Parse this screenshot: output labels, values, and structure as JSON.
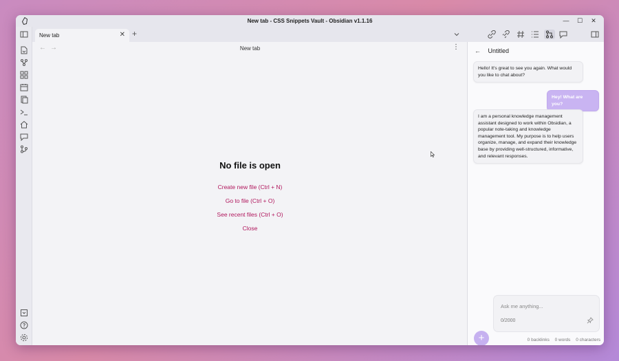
{
  "window": {
    "title": "New tab - CSS Snippets Vault - Obsidian v1.1.16",
    "minimize": "—",
    "maximize": "☐",
    "close": "✕"
  },
  "tabs": [
    {
      "label": "New tab",
      "close": "✕",
      "active": true
    }
  ],
  "new_tab_label": "+",
  "ribbon": {
    "top_icons": [
      "open-quick-switcher-icon",
      "graph-view-icon",
      "canvas-icon",
      "daily-note-icon",
      "templates-icon",
      "command-palette-icon",
      "homepage-icon",
      "chat-icon",
      "git-icon"
    ],
    "bottom_icons": [
      "vault-icon",
      "help-icon",
      "settings-icon"
    ]
  },
  "editor": {
    "view_title": "New tab",
    "back": "←",
    "forward": "→",
    "more": "⋮",
    "empty_title": "No file is open",
    "actions": [
      "Create new file (Ctrl + N)",
      "Go to file (Ctrl + O)",
      "See recent files (Ctrl + O)",
      "Close"
    ]
  },
  "right_toolbar": {
    "icons": [
      "backlinks-icon",
      "outgoing-links-icon",
      "tags-icon",
      "outline-icon",
      "git-changes-icon",
      "chat-icon"
    ],
    "active": "git-changes-icon"
  },
  "chat": {
    "back_arrow": "←",
    "title": "Untitled",
    "messages": [
      {
        "role": "assistant",
        "text": "Hello! It's great to see you again. What would you like to chat about?"
      },
      {
        "role": "user",
        "text": "Hey! What are you?"
      },
      {
        "role": "assistant",
        "text": "I am a personal knowledge management assistant designed to work within Obsidian, a popular note-taking and knowledge management tool. My purpose is to help users organize, manage, and expand their knowledge base by providing well-structured, informative, and relevant responses."
      }
    ],
    "input_placeholder": "Ask me anything...",
    "char_count": "0/2000",
    "add_button": "+"
  },
  "status_bar": {
    "backlinks": "0 backlinks",
    "words": "0 words",
    "characters": "0 characters"
  },
  "colors": {
    "accent": "#b0165c",
    "user_bubble": "#c9b4f2"
  }
}
